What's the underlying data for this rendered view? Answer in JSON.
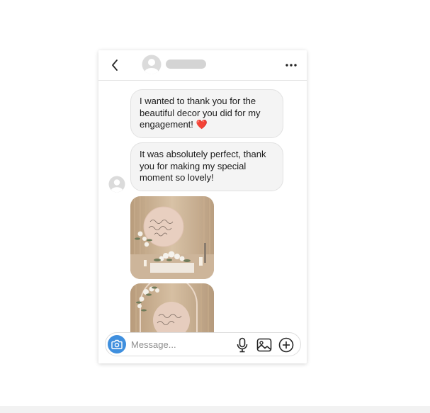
{
  "header": {
    "back_icon": "chevron-left-icon",
    "avatar_icon": "user-avatar-icon",
    "more_icon": "more-horizontal-icon"
  },
  "messages": [
    {
      "line1": "I wanted to thank you  for the",
      "line2": "beautiful decor you did for my",
      "line3": "engagement!",
      "emoji": "❤️"
    },
    {
      "line1": "It was absolutely perfect, thank",
      "line2": "you for making my special",
      "line3": "moment so lovely!"
    }
  ],
  "photos": [
    {
      "description_icon": "photo-engagement-decor-1"
    },
    {
      "description_icon": "photo-engagement-decor-2"
    }
  ],
  "composer": {
    "placeholder": "Message...",
    "camera_icon": "camera-icon",
    "mic_icon": "microphone-icon",
    "gallery_icon": "image-icon",
    "add_icon": "plus-circle-icon"
  },
  "colors": {
    "accent": "#3f8fde",
    "bubble_bg": "#f4f4f4",
    "bubble_border": "#e1e1e1",
    "heart": "#e02a3a"
  }
}
